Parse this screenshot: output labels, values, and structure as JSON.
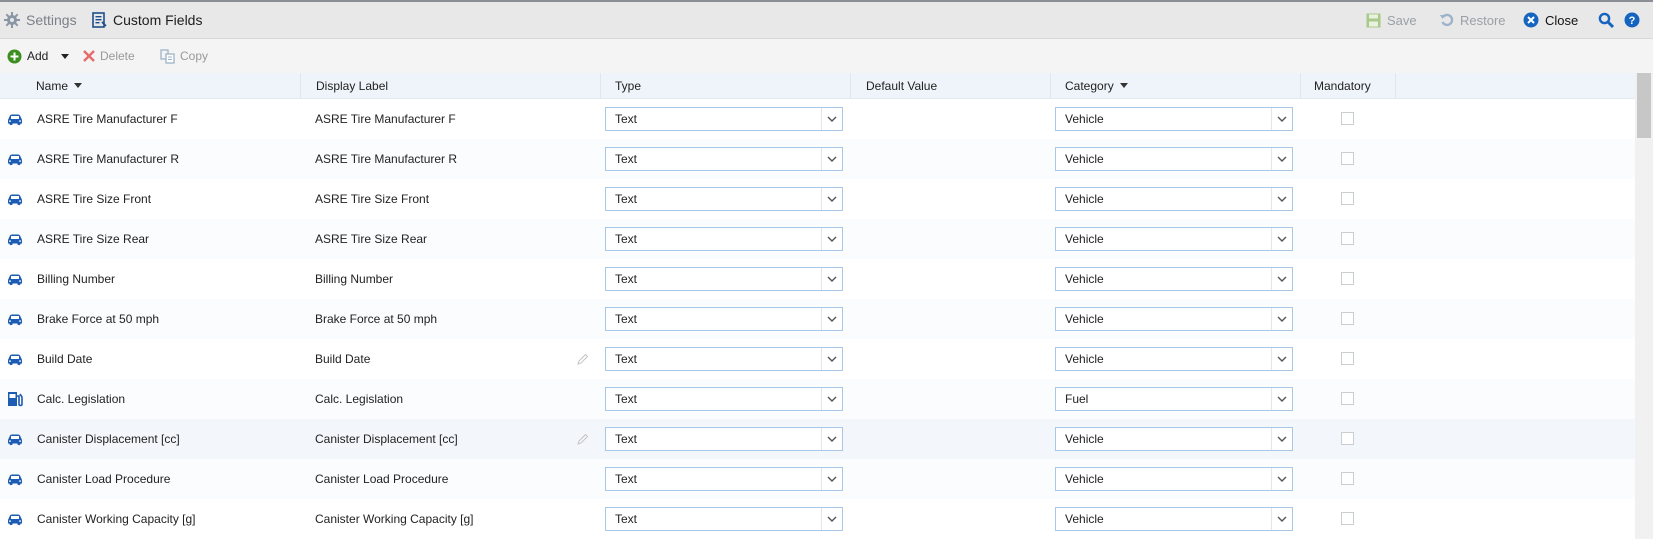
{
  "titlebar": {
    "settings_label": "Settings",
    "page_title": "Custom Fields",
    "save_label": "Save",
    "restore_label": "Restore",
    "close_label": "Close"
  },
  "toolbar": {
    "add_label": "Add",
    "delete_label": "Delete",
    "copy_label": "Copy"
  },
  "columns": {
    "name": "Name",
    "display_label": "Display Label",
    "type": "Type",
    "default_value": "Default Value",
    "category": "Category",
    "mandatory": "Mandatory"
  },
  "colors": {
    "accent_blue": "#1565c0",
    "add_green": "#3a8f1e",
    "delete_red": "#e36b6b",
    "header_bg": "#eef4fa"
  },
  "rows": [
    {
      "icon": "car-icon",
      "name": "ASRE Tire Manufacturer F",
      "label": "ASRE Tire Manufacturer F",
      "type": "Text",
      "category": "Vehicle",
      "mandatory": false
    },
    {
      "icon": "car-icon",
      "name": "ASRE Tire Manufacturer R",
      "label": "ASRE Tire Manufacturer R",
      "type": "Text",
      "category": "Vehicle",
      "mandatory": false
    },
    {
      "icon": "car-icon",
      "name": "ASRE Tire Size Front",
      "label": "ASRE Tire Size Front",
      "type": "Text",
      "category": "Vehicle",
      "mandatory": false
    },
    {
      "icon": "car-icon",
      "name": "ASRE Tire Size Rear",
      "label": "ASRE Tire Size Rear",
      "type": "Text",
      "category": "Vehicle",
      "mandatory": false
    },
    {
      "icon": "car-icon",
      "name": "Billing Number",
      "label": "Billing Number",
      "type": "Text",
      "category": "Vehicle",
      "mandatory": false
    },
    {
      "icon": "car-icon",
      "name": "Brake Force at 50 mph",
      "label": "Brake Force at 50 mph",
      "type": "Text",
      "category": "Vehicle",
      "mandatory": false
    },
    {
      "icon": "car-icon",
      "name": "Build Date",
      "label": "Build Date",
      "type": "Text",
      "category": "Vehicle",
      "mandatory": false
    },
    {
      "icon": "fuel-pump-icon",
      "name": "Calc. Legislation",
      "label": "Calc. Legislation",
      "type": "Text",
      "category": "Fuel",
      "mandatory": false
    },
    {
      "icon": "car-icon",
      "name": "Canister Displacement [cc]",
      "label": "Canister Displacement [cc]",
      "type": "Text",
      "category": "Vehicle",
      "mandatory": false
    },
    {
      "icon": "car-icon",
      "name": "Canister Load Procedure",
      "label": "Canister Load Procedure",
      "type": "Text",
      "category": "Vehicle",
      "mandatory": false
    },
    {
      "icon": "car-icon",
      "name": "Canister Working Capacity [g]",
      "label": "Canister Working Capacity [g]",
      "type": "Text",
      "category": "Vehicle",
      "mandatory": false
    }
  ]
}
